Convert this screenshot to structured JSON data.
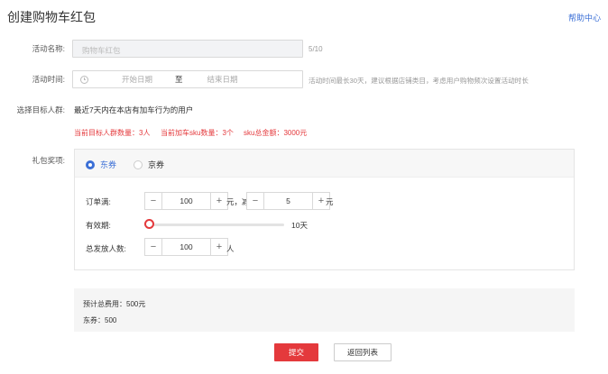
{
  "header": {
    "title": "创建购物车红包",
    "help_link": "帮助中心"
  },
  "form": {
    "name_label": "活动名称:",
    "name_value": "购物车红包",
    "name_counter": "5/10",
    "time_label": "活动时间:",
    "time_start_placeholder": "开始日期",
    "time_separator": "至",
    "time_end_placeholder": "结束日期",
    "time_hint": "活动时间最长30天，建议根据店铺类目，考虑用户购物频次设置活动时长",
    "target_label": "选择目标人群:",
    "target_desc": "最近7天内在本店有加车行为的用户",
    "stat_people": "当前目标人群数量：3人",
    "stat_sku": "当前加车sku数量：3个",
    "stat_amount": "sku总金额：3000元",
    "gift_label": "礼包奖项:",
    "gift_tabs": [
      {
        "label": "东券",
        "selected": true
      },
      {
        "label": "京券",
        "selected": false
      }
    ],
    "order_label": "订单满:",
    "order_value": "100",
    "order_unit": "元，减",
    "discount_value": "5",
    "discount_unit": "元",
    "validity_label": "有效期:",
    "validity_value_text": "10天",
    "validity_fraction": 0.0,
    "total_label": "总发放人数:",
    "total_value": "100",
    "total_unit": "人"
  },
  "summary": {
    "total_cost": "预计总费用：500元",
    "coupon": "东券：500"
  },
  "actions": {
    "submit": "提交",
    "back": "返回列表"
  },
  "colors": {
    "accent": "#3b6fd6",
    "brand_red": "#e4393c"
  }
}
